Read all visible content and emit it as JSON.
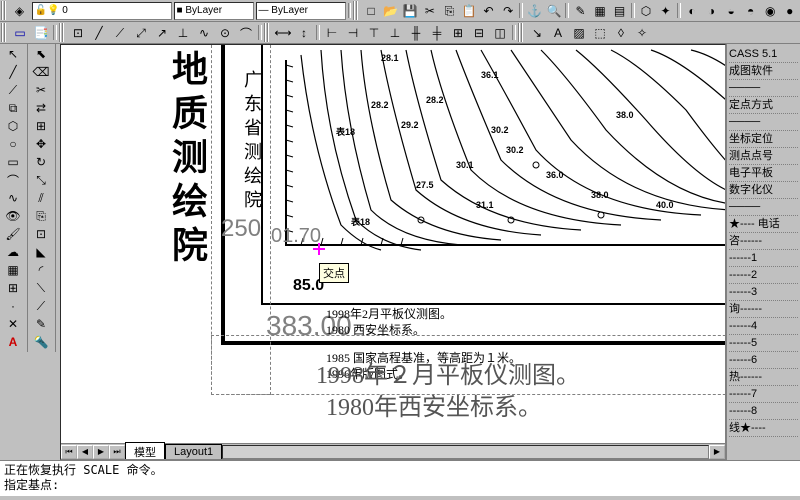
{
  "app": {
    "name": "CASS 5.1",
    "subtitle": "成图软件"
  },
  "toolbar_top1": {
    "icons": [
      "new",
      "open",
      "save",
      "",
      "cut",
      "copy",
      "paste",
      "",
      "undo",
      "redo",
      "",
      "zoom",
      "",
      "anchor",
      "",
      "pencil",
      "eraser",
      "line",
      "",
      "layer",
      "properties",
      "",
      "color",
      "lineweight"
    ]
  },
  "toolbar_top2": {
    "icons": [
      "window",
      "layer",
      "",
      "snap1",
      "snap2",
      "snap3",
      "snap4",
      "snap5",
      "snap6",
      "snap7",
      "",
      "hscale",
      "",
      "dim1",
      "dim2",
      "dim3",
      "dim4",
      "dim5",
      "dim6",
      "dim7",
      "dim8",
      "dim9",
      "",
      "leader",
      "text",
      "mtext",
      "hatch",
      "",
      "filter",
      "block",
      "",
      "wipeout",
      "cloud"
    ]
  },
  "left_tools_a": [
    "select",
    "hand",
    "line",
    "pline",
    "circle",
    "rect",
    "arc",
    "ellipse",
    "wave",
    "eye",
    "roller",
    "pencil",
    "cross",
    "bigA"
  ],
  "left_tools_b": [
    "pick",
    "eraser",
    "mirror",
    "trim",
    "grid",
    "move",
    "rotate",
    "scale",
    "offset",
    "copy",
    "array",
    "chamfer",
    "fillet",
    "torch"
  ],
  "right_panel": {
    "line1": "CASS 5.1",
    "line2": "成图软件",
    "sep1": "────",
    "line3": "定点方式",
    "sep2": "────",
    "line4": "坐标定位",
    "line5": "测点点号",
    "line6": "电子平板",
    "line7": "数字化仪",
    "sep3": "────",
    "line8": "★---- 电话",
    "line9": "咨------",
    "d1": "------1",
    "d2": "------2",
    "d3": "------3",
    "line10": "询------",
    "d4": "------4",
    "d5": "------5",
    "d6": "------6",
    "line11": "热------",
    "d7": "------7",
    "d8": "------8",
    "line12": "线★----"
  },
  "tabs": {
    "active": "模型",
    "inactive": "Layout1"
  },
  "cmd": {
    "line1": "正在恢复执行 SCALE 命令。",
    "line2": "指定基点:"
  },
  "drawing": {
    "title": "地质测绘院",
    "vert_label": "广东省测绘院",
    "coord1": "250",
    "coord2": "01.70",
    "coord3": "383.00",
    "coord4": "85.0",
    "notes": {
      "n1": "1998年2月平板仪测图。",
      "n2": "1980 西安坐标系。",
      "n3": "1985 国家高程基准，等高距为１米。",
      "n4": "1996年版图式。"
    },
    "big_notes": {
      "b1": "1998年２月平板仪测图。",
      "b2": "1980年西安坐标系。"
    },
    "tooltip": "交点",
    "contour_labels": [
      "28.1",
      "28.2",
      "29.2",
      "28.2",
      "30.2",
      "30.1",
      "31.1",
      "30.2",
      "36.1",
      "38.0",
      "36.0",
      "38.0",
      "40.0",
      "27.5",
      "表18",
      "表18"
    ]
  }
}
